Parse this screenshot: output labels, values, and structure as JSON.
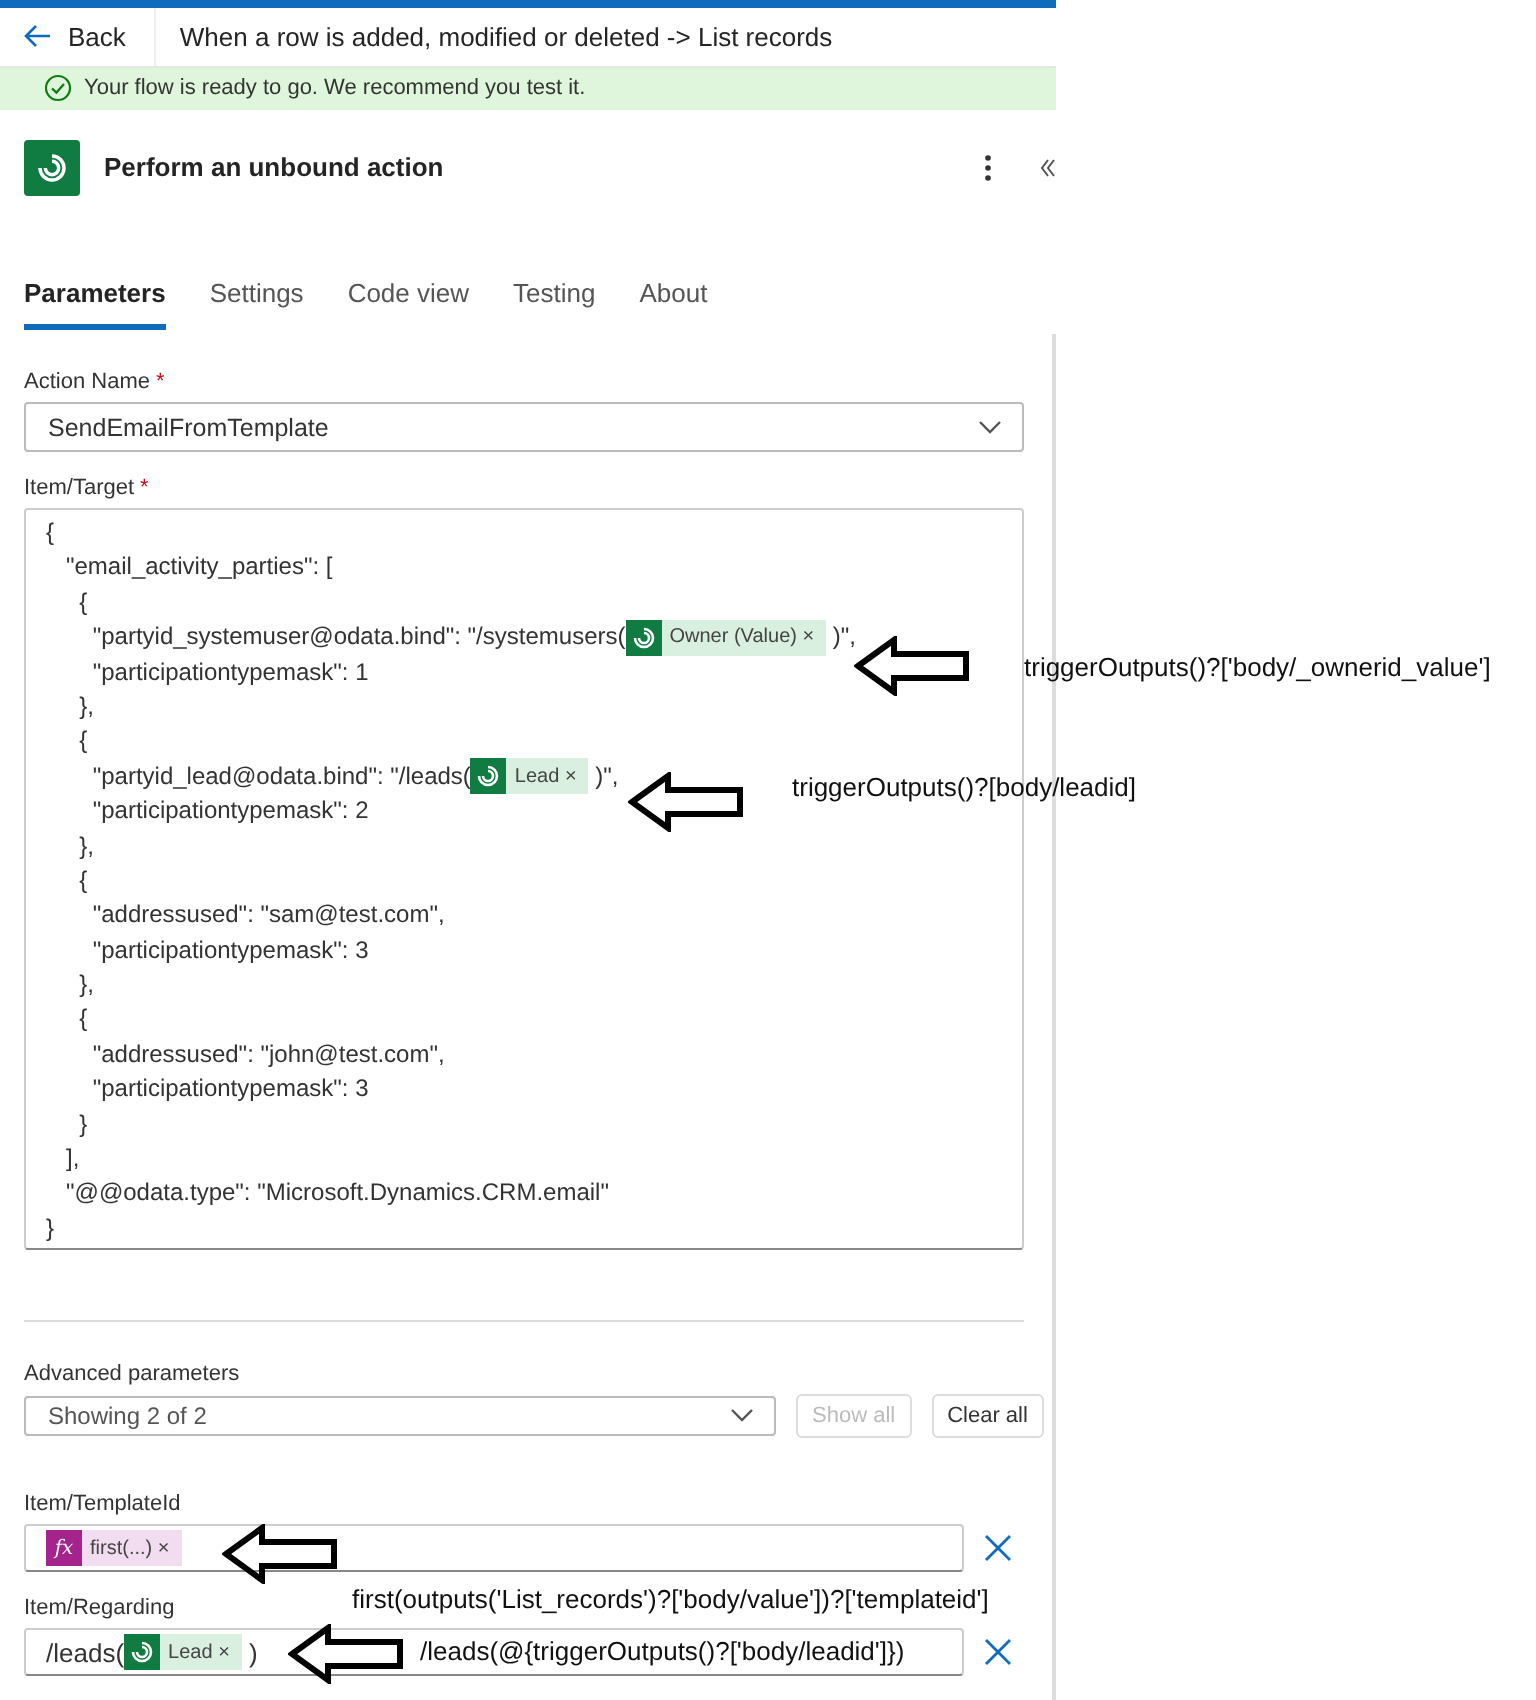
{
  "header": {
    "back": "Back",
    "title": "When a row is added, modified or deleted -> List records"
  },
  "banner": {
    "text": "Your flow is ready to go. We recommend you test it."
  },
  "action": {
    "title": "Perform an unbound action"
  },
  "tabs": [
    {
      "label": "Parameters",
      "selected": true
    },
    {
      "label": "Settings",
      "selected": false
    },
    {
      "label": "Code view",
      "selected": false
    },
    {
      "label": "Testing",
      "selected": false
    },
    {
      "label": "About",
      "selected": false
    }
  ],
  "action_name": {
    "label": "Action Name",
    "mark": "*",
    "value": "SendEmailFromTemplate"
  },
  "item_target": {
    "label": "Item/Target",
    "mark": "*",
    "lines": [
      [
        {
          "kind": "text",
          "text": "{"
        }
      ],
      [
        {
          "kind": "text",
          "text": "   \"email_activity_parties\": ["
        }
      ],
      [
        {
          "kind": "text",
          "text": "     {"
        }
      ],
      [
        {
          "kind": "text",
          "text": "       \"partyid_systemuser@odata.bind\": \"/systemusers("
        },
        {
          "kind": "dataverse_token",
          "label": "Owner (Value)",
          "remove": "×"
        },
        {
          "kind": "text",
          "text": " )\","
        }
      ],
      [
        {
          "kind": "text",
          "text": "       \"participationtypemask\": 1"
        }
      ],
      [
        {
          "kind": "text",
          "text": "     },"
        }
      ],
      [
        {
          "kind": "text",
          "text": "     {"
        }
      ],
      [
        {
          "kind": "text",
          "text": "       \"partyid_lead@odata.bind\": \"/leads("
        },
        {
          "kind": "dataverse_token",
          "label": "Lead",
          "remove": "×"
        },
        {
          "kind": "text",
          "text": " )\","
        }
      ],
      [
        {
          "kind": "text",
          "text": "       \"participationtypemask\": 2"
        }
      ],
      [
        {
          "kind": "text",
          "text": "     },"
        }
      ],
      [
        {
          "kind": "text",
          "text": "     {"
        }
      ],
      [
        {
          "kind": "text",
          "text": "       \"addressused\": \"sam@test.com\","
        }
      ],
      [
        {
          "kind": "text",
          "text": "       \"participationtypemask\": 3"
        }
      ],
      [
        {
          "kind": "text",
          "text": "     },"
        }
      ],
      [
        {
          "kind": "text",
          "text": "     {"
        }
      ],
      [
        {
          "kind": "text",
          "text": "       \"addressused\": \"john@test.com\","
        }
      ],
      [
        {
          "kind": "text",
          "text": "       \"participationtypemask\": 3"
        }
      ],
      [
        {
          "kind": "text",
          "text": "     }"
        }
      ],
      [
        {
          "kind": "text",
          "text": "   ],"
        }
      ],
      [
        {
          "kind": "text",
          "text": "   \"@@odata.type\": \"Microsoft.Dynamics.CRM.email\""
        }
      ],
      [
        {
          "kind": "text",
          "text": "}"
        }
      ]
    ]
  },
  "advanced": {
    "label": "Advanced parameters",
    "value": "Showing 2 of 2",
    "buttons": [
      {
        "label": "Show all",
        "disabled": true
      },
      {
        "label": "Clear all",
        "disabled": false
      }
    ]
  },
  "params": [
    {
      "label": "Item/TemplateId",
      "parts": [
        {
          "kind": "expression_token",
          "icon_text": "fx",
          "label": "first(...)",
          "remove": "×"
        }
      ]
    },
    {
      "label": "Item/Regarding",
      "parts": [
        {
          "kind": "text",
          "text": "/leads("
        },
        {
          "kind": "dataverse_token",
          "label": "Lead",
          "remove": "×"
        },
        {
          "kind": "text",
          "text": " )"
        }
      ]
    }
  ],
  "annotations": [
    {
      "note": "triggerOutputs()?['body/_ownerid_value']"
    },
    {
      "note": "triggerOutputs()?[body/leadid]"
    },
    {
      "note": "first(outputs('List_records')?['body/value'])?['templateid']"
    },
    {
      "note": "/leads(@{triggerOutputs()?['body/leadid']})"
    }
  ]
}
